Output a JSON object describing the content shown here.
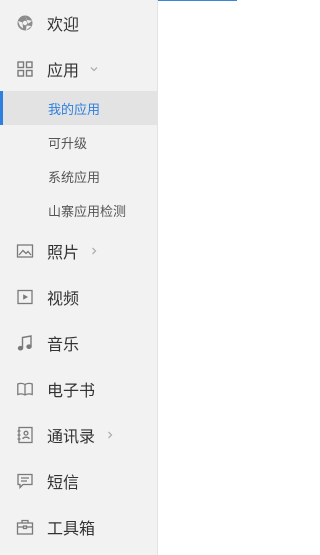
{
  "accent_color": "#2d7fe0",
  "nav": {
    "welcome": {
      "label": "欢迎",
      "icon": "welcome-icon"
    },
    "apps": {
      "label": "应用",
      "icon": "apps-grid-icon",
      "expanded": true,
      "children": [
        {
          "label": "我的应用",
          "active": true
        },
        {
          "label": "可升级",
          "active": false
        },
        {
          "label": "系统应用",
          "active": false
        },
        {
          "label": "山寨应用检测",
          "active": false
        }
      ]
    },
    "photos": {
      "label": "照片",
      "icon": "image-icon",
      "has_children": true
    },
    "videos": {
      "label": "视频",
      "icon": "video-icon"
    },
    "music": {
      "label": "音乐",
      "icon": "music-note-icon"
    },
    "ebooks": {
      "label": "电子书",
      "icon": "book-icon"
    },
    "contacts": {
      "label": "通讯录",
      "icon": "contacts-icon",
      "has_children": true
    },
    "sms": {
      "label": "短信",
      "icon": "message-icon"
    },
    "toolbox": {
      "label": "工具箱",
      "icon": "toolbox-icon"
    }
  }
}
